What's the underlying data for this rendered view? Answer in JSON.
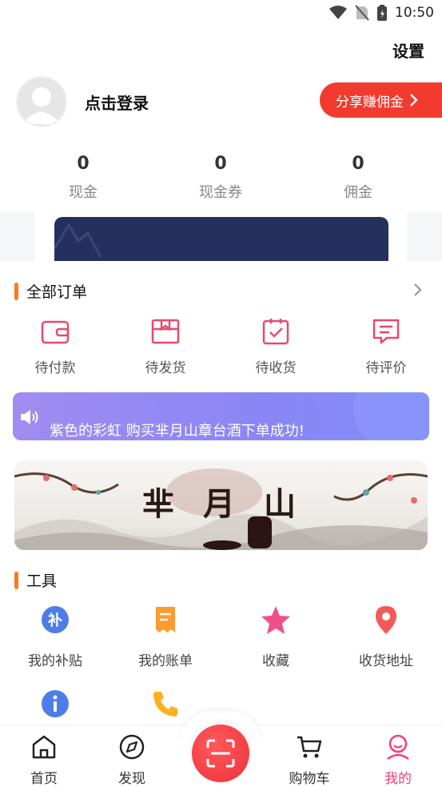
{
  "status_bar": {
    "time": "10:50"
  },
  "header": {
    "settings_label": "设置"
  },
  "profile": {
    "login_text": "点击登录",
    "share_button": "分享赚佣金"
  },
  "stats": [
    {
      "value": "0",
      "label": "现金"
    },
    {
      "value": "0",
      "label": "现金券"
    },
    {
      "value": "0",
      "label": "佣金"
    }
  ],
  "orders": {
    "title": "全部订单",
    "items": [
      {
        "label": "待付款",
        "icon": "wallet-icon"
      },
      {
        "label": "待发货",
        "icon": "package-icon"
      },
      {
        "label": "待收货",
        "icon": "receive-icon"
      },
      {
        "label": "待评价",
        "icon": "comment-icon"
      }
    ]
  },
  "notice": {
    "text": "紫色的彩虹 购买芈月山章台酒下单成功!"
  },
  "banner": {
    "title": "芈月山"
  },
  "tools": {
    "title": "工具",
    "items": [
      {
        "label": "我的补贴",
        "icon": "subsidy-icon"
      },
      {
        "label": "我的账单",
        "icon": "bill-icon"
      },
      {
        "label": "收藏",
        "icon": "star-icon"
      },
      {
        "label": "收货地址",
        "icon": "location-icon"
      }
    ],
    "row2": [
      {
        "icon": "info-icon"
      },
      {
        "icon": "phone-icon"
      }
    ]
  },
  "bottom_nav": {
    "items": [
      {
        "label": "首页",
        "icon": "home-icon"
      },
      {
        "label": "发现",
        "icon": "compass-icon"
      },
      {
        "label": "购物车",
        "icon": "cart-icon"
      },
      {
        "label": "我的",
        "icon": "profile-icon"
      }
    ],
    "active_color": "#f0407a"
  },
  "colors": {
    "accent_red": "#f23a2e",
    "order_pink": "#e84a6c",
    "vip_card": "#24305e",
    "title_bar": "#ff7a1a"
  }
}
